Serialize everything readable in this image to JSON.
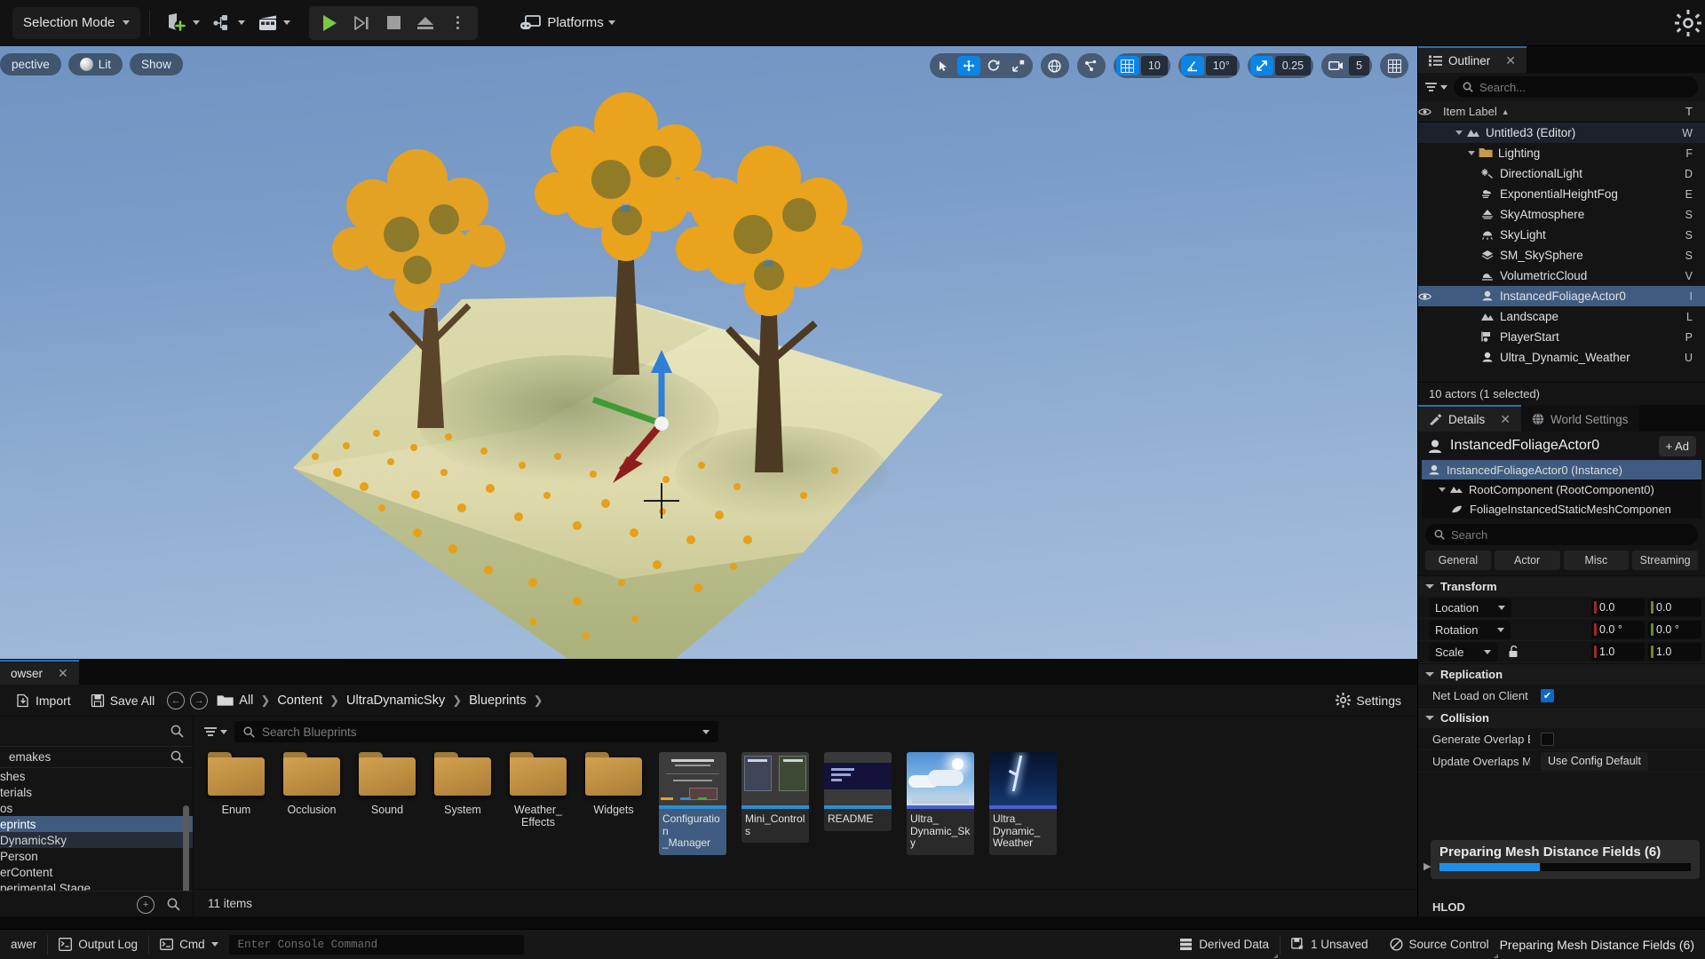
{
  "toolbar": {
    "mode_label": "Selection Mode",
    "add_icon": "add-actor-icon",
    "blueprint_icon": "blueprints-icon",
    "cinematics_icon": "cinematics-icon",
    "play_icon": "play-icon",
    "skip_icon": "skip-icon",
    "stop_icon": "stop-icon",
    "eject_icon": "eject-icon",
    "more_icon": "more-options-icon",
    "platforms_label": "Platforms",
    "settings_icon": "settings-gear-icon"
  },
  "viewport": {
    "perspective_label": "pective",
    "lit_label": "Lit",
    "show_label": "Show",
    "transform_tools": [
      "select-icon",
      "move-icon",
      "rotate-icon",
      "scale-icon"
    ],
    "coord_icon": "world-coordinate-icon",
    "snap_icon": "surface-snap-icon",
    "grid_snap": {
      "icon": "grid-snap-icon",
      "value": "10",
      "enabled": true
    },
    "angle_snap": {
      "icon": "angle-snap-icon",
      "value": "10°",
      "enabled": true
    },
    "scale_snap": {
      "icon": "scale-snap-icon",
      "value": "0.25",
      "enabled": true
    },
    "camera_speed": {
      "icon": "camera-icon",
      "value": "5",
      "enabled": false
    },
    "layout_icon": "viewport-layout-icon"
  },
  "outliner": {
    "tab_label": "Outliner",
    "close_icon": "close-icon",
    "filter_icon": "filter-icon",
    "search_placeholder": "Search...",
    "columns": {
      "visibility": "eye-icon",
      "item_label": "Item Label",
      "sort": "▲",
      "type": "T"
    },
    "items": [
      {
        "label": "Untitled3 (Editor)",
        "icon": "level-icon",
        "depth": 1,
        "state": "root",
        "expandable": true,
        "visible": false,
        "type": "W"
      },
      {
        "label": "Lighting",
        "icon": "folder-icon",
        "depth": 2,
        "state": "normal",
        "expandable": true,
        "visible": false,
        "type": "F"
      },
      {
        "label": "DirectionalLight",
        "icon": "directional-light-icon",
        "depth": 3,
        "state": "normal",
        "expandable": false,
        "visible": false,
        "type": "D"
      },
      {
        "label": "ExponentialHeightFog",
        "icon": "fog-icon",
        "depth": 3,
        "state": "normal",
        "expandable": false,
        "visible": false,
        "type": "E"
      },
      {
        "label": "SkyAtmosphere",
        "icon": "sky-atmosphere-icon",
        "depth": 3,
        "state": "normal",
        "expandable": false,
        "visible": false,
        "type": "S"
      },
      {
        "label": "SkyLight",
        "icon": "sky-light-icon",
        "depth": 3,
        "state": "normal",
        "expandable": false,
        "visible": false,
        "type": "S"
      },
      {
        "label": "SM_SkySphere",
        "icon": "static-mesh-icon",
        "depth": 3,
        "state": "normal",
        "expandable": false,
        "visible": false,
        "type": "S"
      },
      {
        "label": "VolumetricCloud",
        "icon": "volumetric-cloud-icon",
        "depth": 3,
        "state": "normal",
        "expandable": false,
        "visible": false,
        "type": "V"
      },
      {
        "label": "InstancedFoliageActor0",
        "icon": "actor-icon",
        "depth": 3,
        "state": "selected",
        "expandable": false,
        "visible": true,
        "type": "I"
      },
      {
        "label": "Landscape",
        "icon": "landscape-icon",
        "depth": 3,
        "state": "normal",
        "expandable": false,
        "visible": false,
        "type": "L"
      },
      {
        "label": "PlayerStart",
        "icon": "player-start-icon",
        "depth": 3,
        "state": "normal",
        "expandable": false,
        "visible": false,
        "type": "P"
      },
      {
        "label": "Ultra_Dynamic_Weather",
        "icon": "actor-icon",
        "depth": 3,
        "state": "normal",
        "expandable": false,
        "visible": false,
        "type": "U"
      }
    ],
    "status": "10 actors (1 selected)"
  },
  "details": {
    "tabs": [
      {
        "label": "Details",
        "icon": "details-icon",
        "active": true,
        "closeable": true
      },
      {
        "label": "World Settings",
        "icon": "world-settings-icon",
        "active": false,
        "closeable": false
      }
    ],
    "close_icon": "close-icon",
    "actor_name": "InstancedFoliageActor0",
    "actor_icon": "actor-icon",
    "add_button": "+ Ad",
    "components": [
      {
        "label": "InstancedFoliageActor0 (Instance)",
        "icon": "actor-icon",
        "depth": 0,
        "selected": true,
        "expandable": false
      },
      {
        "label": "RootComponent (RootComponent0)",
        "icon": "scene-component-icon",
        "depth": 1,
        "selected": false,
        "expandable": true
      },
      {
        "label": "FoliageInstancedStaticMeshComponen",
        "icon": "foliage-component-icon",
        "depth": 2,
        "selected": false,
        "expandable": false
      }
    ],
    "search_placeholder": "Search",
    "filter_tabs": [
      "General",
      "Actor",
      "Misc",
      "Streaming"
    ],
    "sections": [
      {
        "title": "Transform",
        "rows": [
          {
            "label": "Location",
            "type": "vector",
            "dropdown": true,
            "values": [
              "0.0",
              "0.0"
            ]
          },
          {
            "label": "Rotation",
            "type": "vector",
            "dropdown": true,
            "values": [
              "0.0 °",
              "0.0 °"
            ]
          },
          {
            "label": "Scale",
            "type": "vector",
            "dropdown": true,
            "lock_icon": "unlock-icon",
            "values": [
              "1.0",
              "1.0"
            ]
          }
        ]
      },
      {
        "title": "Replication",
        "rows": [
          {
            "label": "Net Load on Client",
            "type": "checkbox",
            "checked": true
          }
        ]
      },
      {
        "title": "Collision",
        "rows": [
          {
            "label": "Generate Overlap Events Du...",
            "type": "checkbox",
            "checked": false
          },
          {
            "label": "Update Overlaps Method Du...",
            "type": "combo",
            "value": "Use Config Default"
          }
        ]
      }
    ],
    "progress": {
      "label": "Preparing Mesh Distance Fields (6)",
      "percent": 40,
      "expand_icon": "expand-arrow-icon"
    },
    "next_section": "HLOD"
  },
  "content_browser": {
    "tab_label": "owser",
    "close_icon": "close-icon",
    "import_label": "Import",
    "save_all_label": "Save All",
    "back_icon": "back-arrow-icon",
    "forward_icon": "forward-arrow-icon",
    "path_icon": "folder-icon",
    "breadcrumb": [
      "All",
      "Content",
      "UltraDynamicSky",
      "Blueprints"
    ],
    "settings_label": "Settings",
    "settings_icon": "gear-icon",
    "left_panel": {
      "search_icon": "search-icon",
      "favorites_label": "emakes",
      "tree": [
        {
          "label": "perimental Stage",
          "state": "cut"
        },
        {
          "label": "erContent",
          "state": "normal"
        },
        {
          "label": "Person",
          "state": "normal"
        },
        {
          "label": "DynamicSky",
          "state": "highlight"
        },
        {
          "label": "eprints",
          "state": "selected"
        },
        {
          "label": "os",
          "state": "normal"
        },
        {
          "label": "terials",
          "state": "normal"
        },
        {
          "label": "shes",
          "state": "cut"
        }
      ],
      "add_icon": "add-icon",
      "footer_search_icon": "search-icon"
    },
    "search_placeholder": "Search Blueprints",
    "filter_icon": "filter-icon",
    "search_icon": "search-icon",
    "dropdown_icon": "chevron-down-icon",
    "folders": [
      "Enum",
      "Occlusion",
      "Sound",
      "System",
      "Weather_\nEffects",
      "Widgets"
    ],
    "assets": [
      {
        "label": "Configuration\n_Manager",
        "thumb": "ui-diagram",
        "bar": "blueprint",
        "selected": true
      },
      {
        "label": "Mini_Controls",
        "thumb": "ui-panels",
        "bar": "blueprint",
        "selected": false
      },
      {
        "label": "README",
        "thumb": "dark-text",
        "bar": "blueprint",
        "selected": false
      },
      {
        "label": "Ultra_\nDynamic_Sky",
        "thumb": "sky-clouds",
        "bar": "actor",
        "selected": false
      },
      {
        "label": "Ultra_\nDynamic_\nWeather",
        "thumb": "lightning",
        "bar": "actor",
        "selected": false
      }
    ],
    "item_count": "11 items"
  },
  "status_bar": {
    "drawer_label": "awer",
    "output_log_label": "Output Log",
    "output_log_icon": "output-log-icon",
    "cmd_label": "Cmd",
    "cmd_icon": "cmd-icon",
    "console_placeholder": "Enter Console Command",
    "derived_data_label": "Derived Data",
    "derived_data_icon": "derived-data-icon",
    "unsaved_label": "1 Unsaved",
    "unsaved_icon": "unsaved-icon",
    "source_control_label": "Source Control",
    "source_control_icon": "source-control-icon",
    "progress_label": "Preparing Mesh Distance Fields (6)"
  },
  "colors": {
    "accent_blue": "#0b84e8",
    "selection_blue": "#3f5c80",
    "play_green": "#7ac943",
    "folder_gold": "#c2923f",
    "panel_bg": "#141414"
  }
}
